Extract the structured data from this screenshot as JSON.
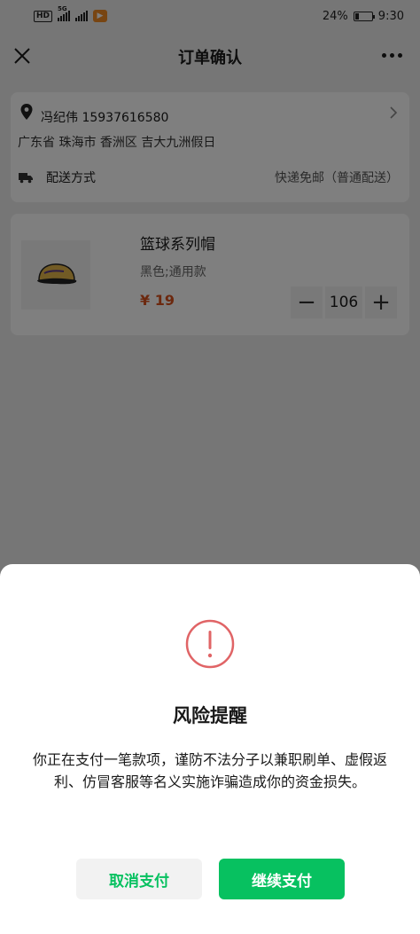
{
  "status_bar": {
    "network": "HD",
    "signal_label": "5G",
    "battery": "24%",
    "battery_level": 0.24,
    "time": "9:30"
  },
  "navbar": {
    "title": "订单确认",
    "close_icon": "close-icon",
    "more_icon": "more-icon"
  },
  "address": {
    "name_phone": "冯纪伟 15937616580",
    "detail": "广东省 珠海市 香洲区 吉大九洲假日",
    "icon": "location-pin-icon"
  },
  "delivery": {
    "label": "配送方式",
    "value": "快递免邮（普通配送）",
    "icon": "truck-icon"
  },
  "product": {
    "name": "篮球系列帽",
    "spec": "黑色;通用款",
    "price": "¥ 19",
    "quantity": "106",
    "minus": "−",
    "plus": "+"
  },
  "modal": {
    "title": "风险提醒",
    "message": "你正在支付一笔款项，谨防不法分子以兼职刷单、虚假返利、仿冒客服等名义实施诈骗造成你的资金损失。",
    "cancel_label": "取消支付",
    "continue_label": "继续支付",
    "icon": "warning-icon"
  },
  "colors": {
    "accent_green": "#07c160",
    "price_orange": "#d9501c",
    "warning_red": "#e06466"
  }
}
